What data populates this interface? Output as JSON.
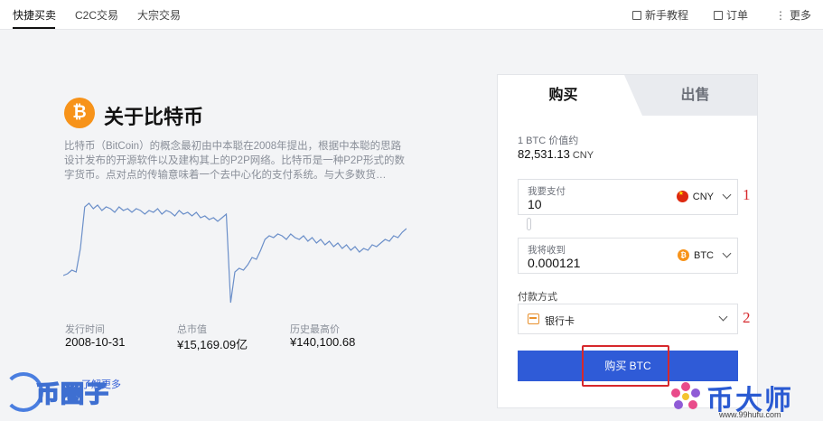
{
  "nav": {
    "tabs": [
      {
        "label": "快捷买卖",
        "active": true
      },
      {
        "label": "C2C交易",
        "active": false
      },
      {
        "label": "大宗交易",
        "active": false
      }
    ],
    "right": [
      {
        "label": "新手教程",
        "icon": "video-icon"
      },
      {
        "label": "订单",
        "icon": "order-icon"
      },
      {
        "label": "更多",
        "icon": "more-icon"
      }
    ]
  },
  "about": {
    "logo": "₿",
    "title": "关于比特币",
    "description": "比特币（BitCoin）的概念最初由中本聪在2008年提出，根据中本聪的思路设计发布的开源软件以及建构其上的P2P网络。比特币是一种P2P形式的数字货币。点对点的传输意味着一个去中心化的支付系统。与大多数货…"
  },
  "chart_data": {
    "type": "line",
    "title": "",
    "xlabel": "",
    "ylabel": "",
    "grid": false,
    "legend": "none",
    "x": [
      0,
      1,
      2,
      3,
      4,
      5,
      6,
      7,
      8,
      9,
      10,
      11,
      12,
      13,
      14,
      15,
      16,
      17,
      18,
      19,
      20,
      21,
      22,
      23,
      24,
      25,
      26,
      27,
      28,
      29,
      30,
      31,
      32,
      33,
      34,
      35,
      36,
      37,
      38,
      39,
      40,
      41,
      42,
      43,
      44,
      45,
      46,
      47,
      48,
      49,
      50,
      51,
      52,
      53,
      54,
      55,
      56,
      57,
      58,
      59,
      60,
      61,
      62,
      63,
      64,
      65,
      66,
      67,
      68,
      69,
      70,
      71,
      72,
      73,
      74,
      75,
      76,
      77,
      78,
      79,
      80
    ],
    "values": [
      20,
      21,
      23,
      22,
      35,
      58,
      60,
      57,
      59,
      56,
      58,
      57,
      55,
      58,
      56,
      57,
      55,
      57,
      56,
      54,
      56,
      55,
      57,
      54,
      56,
      55,
      53,
      56,
      54,
      55,
      53,
      55,
      52,
      53,
      51,
      52,
      50,
      52,
      54,
      5,
      22,
      24,
      23,
      26,
      30,
      29,
      34,
      40,
      42,
      41,
      43,
      42,
      40,
      43,
      41,
      40,
      42,
      39,
      41,
      38,
      40,
      37,
      39,
      36,
      38,
      35,
      37,
      34,
      36,
      33,
      35,
      34,
      37,
      36,
      38,
      40,
      39,
      42,
      41,
      44,
      46
    ],
    "color": "#6b8fc9",
    "ylim": [
      0,
      70
    ]
  },
  "stats": [
    {
      "label": "发行时间",
      "value": "2008-10-31"
    },
    {
      "label": "总市值",
      "value": "¥15,169.09亿"
    },
    {
      "label": "历史最高价",
      "value": "¥140,100.68"
    }
  ],
  "learn_more": "了解更多",
  "panel": {
    "buy_tab": "购买",
    "sell_tab": "出售",
    "price_label": "1 BTC 价值约",
    "price_value": "82,531.13",
    "price_unit": "CNY",
    "pay_field": {
      "label": "我要支付",
      "value": "10",
      "currency": "CNY",
      "icon": "cny-flag-icon"
    },
    "receive_field": {
      "label": "我将收到",
      "value": "0.000121",
      "currency": "BTC",
      "icon": "btc-coin-icon"
    },
    "payment_method_label": "付款方式",
    "payment_method_value": "银行卡",
    "buy_button": "购买 BTC"
  },
  "annotations": {
    "one": "1",
    "two": "2"
  },
  "watermarks": {
    "left": "币圈子",
    "right": "币大师",
    "right_url": "www.99hufu.com"
  },
  "colors": {
    "accent": "#2f5bd7",
    "btc": "#f7931a",
    "annotation": "#d6282c"
  }
}
